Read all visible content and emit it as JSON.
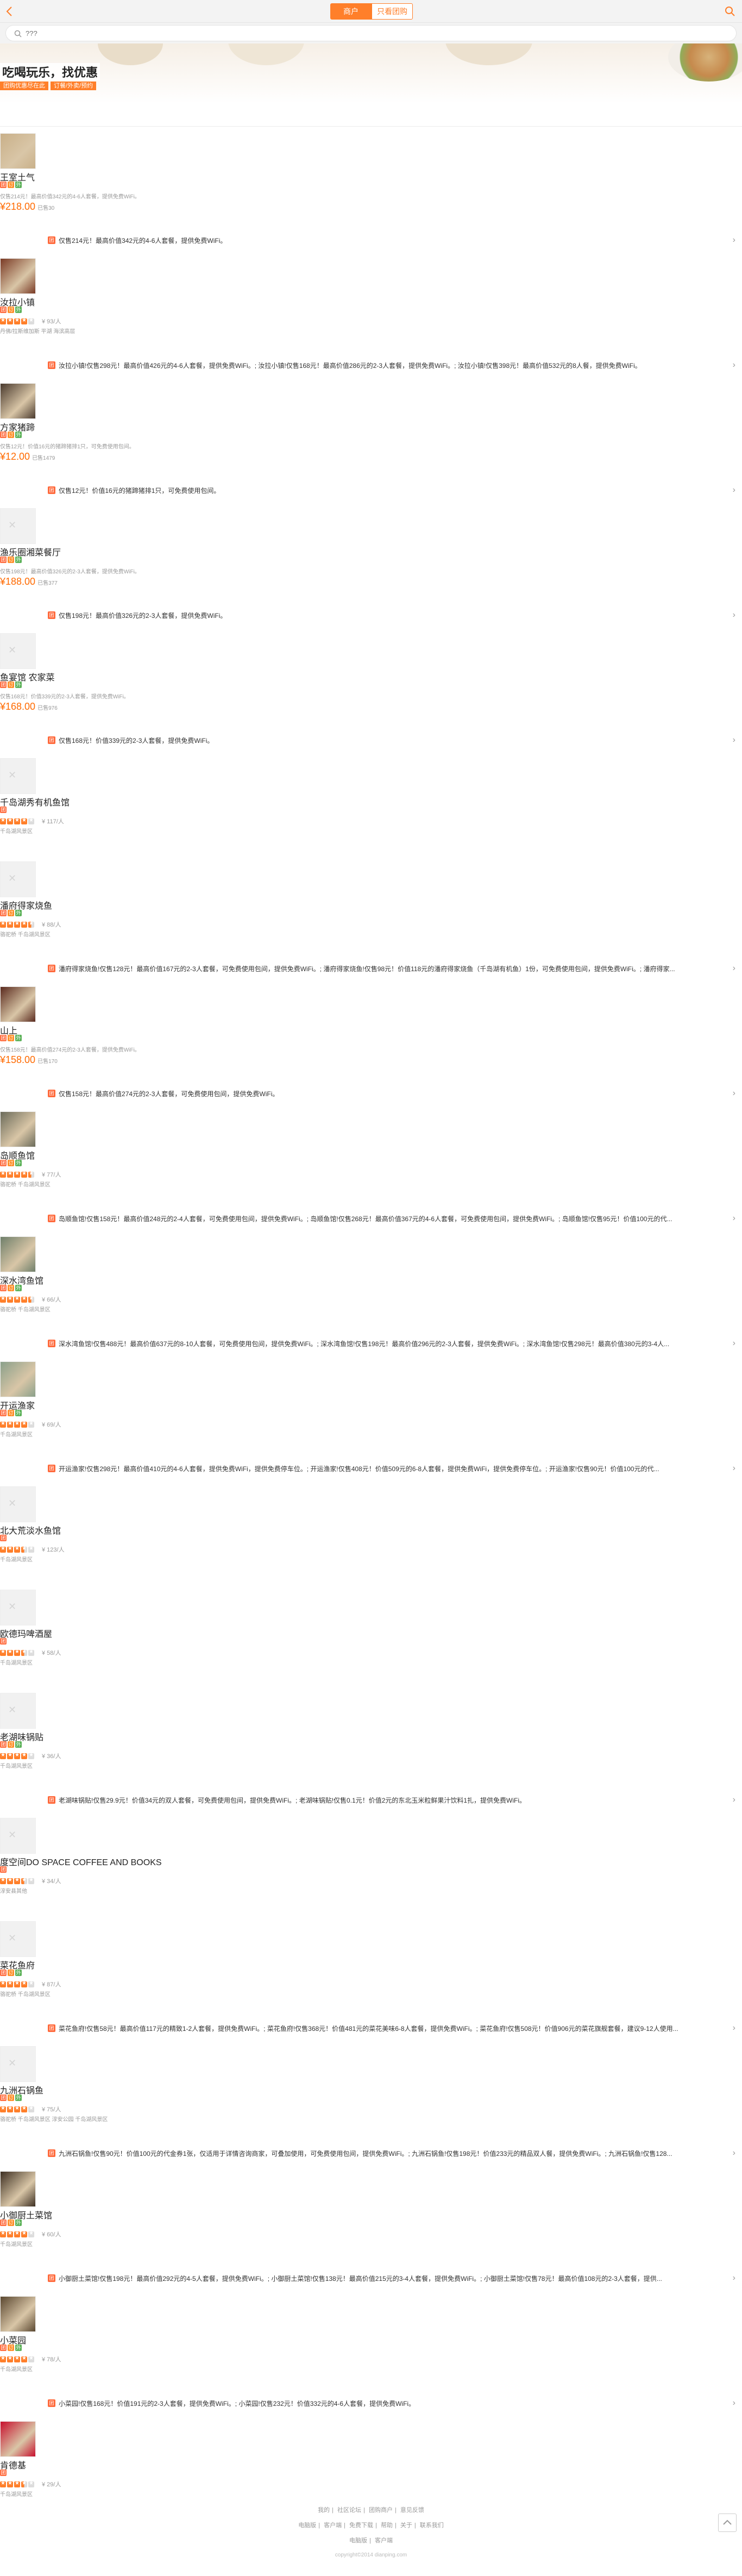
{
  "header": {
    "tabs": [
      {
        "label": "商户",
        "active": true
      },
      {
        "label": "只看团购",
        "active": false
      }
    ]
  },
  "search": {
    "placeholder": "???"
  },
  "banner": {
    "title": "吃喝玩乐，找优惠",
    "tags": [
      "团购优惠尽在此",
      "订餐/外卖/预约"
    ]
  },
  "colors": {
    "accent": "#ff7f2a",
    "price": "#ff6a00"
  },
  "items": [
    {
      "name": "王室土气",
      "kind": "deal",
      "desc": "仅售214元！最高价值342元的4-6人套餐，提供免费WiFi。",
      "price": "218.00",
      "sold": "已售30",
      "deal": "仅售214元！最高价值342元的4-6人套餐，提供免费WiFi。",
      "thumb": "#c9b089"
    },
    {
      "name": "汝拉小镇",
      "kind": "rated",
      "rating": 4,
      "reviews": "¥ 93/人",
      "area": "丹佛/拉斯维加斯 平湖 海滨高层",
      "deal": "汝拉小镇!仅售298元！最高价值426元的4-6人套餐，提供免费WiFi。; 汝拉小镇!仅售168元！最高价值286元的2-3人套餐，提供免费WiFi。; 汝拉小镇!仅售398元！最高价值532元的8人餐，提供免费WiFi。",
      "thumb": "#7a3a25"
    },
    {
      "name": "方家猪蹄",
      "kind": "deal",
      "desc": "仅售12元！价值16元的猪蹄猪排1只，可免费使用包间。",
      "price": "12.00",
      "sold": "已售1479",
      "deal": "仅售12元！价值16元的猪蹄猪排1只，可免费使用包间。",
      "thumb": "#4a3a2e"
    },
    {
      "name": "渔乐圈湘菜餐厅",
      "kind": "deal",
      "desc": "仅售198元！最高价值326元的2-3人套餐，提供免费WiFi。",
      "price": "188.00",
      "sold": "已售377",
      "deal": "仅售198元！最高价值326元的2-3人套餐，提供免费WiFi。",
      "thumb": ""
    },
    {
      "name": "鱼宴馆 农家菜",
      "kind": "deal",
      "desc": "仅售168元！价值339元的2-3人套餐，提供免费WiFi。",
      "price": "168.00",
      "sold": "已售976",
      "deal": "仅售168元！价值339元的2-3人套餐，提供免费WiFi。",
      "thumb": ""
    },
    {
      "name": "千岛湖秀有机鱼馆",
      "kind": "rated",
      "rating": 4,
      "reviews": "¥ 117/人",
      "area": "千岛湖风景区",
      "deal": "",
      "thumb": ""
    },
    {
      "name": "潘府得家烧鱼",
      "kind": "rated",
      "rating": 4.5,
      "reviews": "¥ 88/人",
      "area": "骆驼桥 千岛湖风景区",
      "deal": "潘府得家烧鱼!仅售128元！最高价值167元的2-3人套餐，可免费使用包间，提供免费WiFi。; 潘府得家烧鱼!仅售98元！价值118元的潘府得家烧鱼（千岛湖有机鱼）1份，可免费使用包间，提供免费WiFi。; 潘府得家...",
      "thumb": ""
    },
    {
      "name": "山上",
      "kind": "deal",
      "desc": "仅售158元！最高价值274元的2-3人套餐，提供免费WiFi。",
      "price": "158.00",
      "sold": "已售170",
      "deal": "仅售158元！最高价值274元的2-3人套餐，可免费使用包间，提供免费WiFi。",
      "thumb": "#5a2a1e"
    },
    {
      "name": "岛顺鱼馆",
      "kind": "rated",
      "rating": 4.5,
      "reviews": "¥ 77/人",
      "area": "骆驼桥 千岛湖风景区",
      "deal": "岛顺鱼馆!仅售158元！最高价值248元的2-4人套餐，可免费使用包间，提供免费WiFi。; 岛顺鱼馆!仅售268元！最高价值367元的4-6人套餐，可免费使用包间，提供免费WiFi。; 岛顺鱼馆!仅售95元！价值100元的代...",
      "thumb": "#6b6b5a"
    },
    {
      "name": "深水湾鱼馆",
      "kind": "rated",
      "rating": 4.5,
      "reviews": "¥ 66/人",
      "area": "骆驼桥 千岛湖风景区",
      "deal": "深水湾鱼馆!仅售488元！最高价值637元的8-10人套餐，可免费使用包间，提供免费WiFi。; 深水湾鱼馆!仅售198元！最高价值296元的2-3人套餐，提供免费WiFi。; 深水湾鱼馆!仅售298元！最高价值380元的3-4人...",
      "thumb": "#6f7f6a"
    },
    {
      "name": "开运渔家",
      "kind": "rated",
      "rating": 4,
      "reviews": "¥ 69/人",
      "area": "千岛湖风景区",
      "deal": "开运渔家!仅售298元！最高价值410元的4-6人套餐，提供免费WiFi，提供免费停车位。; 开运渔家!仅售408元！价值509元的6-8人套餐，提供免费WiFi，提供免费停车位。; 开运渔家!仅售90元！价值100元的代...",
      "thumb": "#8aa08a"
    },
    {
      "name": "北大荒淡水鱼馆",
      "kind": "rated",
      "rating": 3.5,
      "reviews": "¥ 123/人",
      "area": "千岛湖风景区",
      "deal": "",
      "thumb": ""
    },
    {
      "name": "欧德玛啤酒屋",
      "kind": "rated",
      "rating": 3.5,
      "reviews": "¥ 58/人",
      "area": "千岛湖风景区",
      "deal": "",
      "thumb": ""
    },
    {
      "name": "老湖味锅贴",
      "kind": "rated",
      "rating": 4,
      "reviews": "¥ 36/人",
      "area": "千岛湖风景区",
      "deal": "老湖味锅贴!仅售29.9元！价值34元的双人套餐，可免费使用包间，提供免费WiFi。; 老湖味锅贴!仅售0.1元！价值2元的东北玉米粒鲜果汁饮料1扎，提供免费WiFi。",
      "thumb": ""
    },
    {
      "name": "度空间DO SPACE COFFEE AND BOOKS",
      "kind": "rated",
      "rating": 3.5,
      "reviews": "¥ 34/人",
      "area": "淳安县其他",
      "deal": "",
      "thumb": ""
    },
    {
      "name": "菜花鱼府",
      "kind": "rated",
      "rating": 4,
      "reviews": "¥ 87/人",
      "area": "骆驼桥 千岛湖风景区",
      "deal": "菜花鱼府!仅售58元！最高价值117元的精致1-2人套餐，提供免费WiFi。; 菜花鱼府!仅售368元！价值481元的菜花美味6-8人套餐，提供免费WiFi。; 菜花鱼府!仅售508元！价值906元的菜花旗舰套餐，建议9-12人使用...",
      "thumb": ""
    },
    {
      "name": "九洲石锅鱼",
      "kind": "rated",
      "rating": 4,
      "reviews": "¥ 75/人",
      "area": "骆驼桥 千岛湖风景区 淳安公园 千岛湖风景区",
      "deal": "九洲石锅鱼!仅售90元！价值100元的代金券1张，仅适用于详情咨询商家，可叠加使用，可免费使用包间，提供免费WiFi。; 九洲石锅鱼!仅售198元！价值233元的精品双人餐，提供免费WiFi。; 九洲石锅鱼!仅售128...",
      "thumb": ""
    },
    {
      "name": "小御厨土菜馆",
      "kind": "rated",
      "rating": 4,
      "reviews": "¥ 60/人",
      "area": "千岛湖风景区",
      "deal": "小御厨土菜馆!仅售198元！最高价值292元的4-5人套餐，提供免费WiFi。; 小御厨土菜馆!仅售138元！最高价值215元的3-4人套餐，提供免费WiFi。; 小御厨土菜馆!仅售78元！最高价值108元的2-3人套餐，提供...",
      "thumb": "#3d2f22"
    },
    {
      "name": "小菜园",
      "kind": "rated",
      "rating": 4,
      "reviews": "¥ 78/人",
      "area": "千岛湖风景区",
      "deal": "小菜园!仅售168元！价值191元的2-3人套餐，提供免费WiFi。; 小菜园!仅售232元！价值332元的4-6人套餐，提供免费WiFi。",
      "thumb": "#5a4730"
    },
    {
      "name": "肯德基",
      "kind": "rated",
      "rating": 3.5,
      "reviews": "¥ 29/人",
      "area": "千岛湖风景区",
      "deal": "",
      "thumb": "#c8102e"
    }
  ],
  "footer": {
    "links1": [
      "我的",
      "社区论坛",
      "团购商户",
      "意见反馈"
    ],
    "links2": [
      "电脑版",
      "客户端",
      "免费下载",
      "帮助",
      "关于",
      "联系我们"
    ],
    "links3": [
      "电脑版",
      "客户端"
    ],
    "copyright": "copyright©2014 dianping.com"
  }
}
